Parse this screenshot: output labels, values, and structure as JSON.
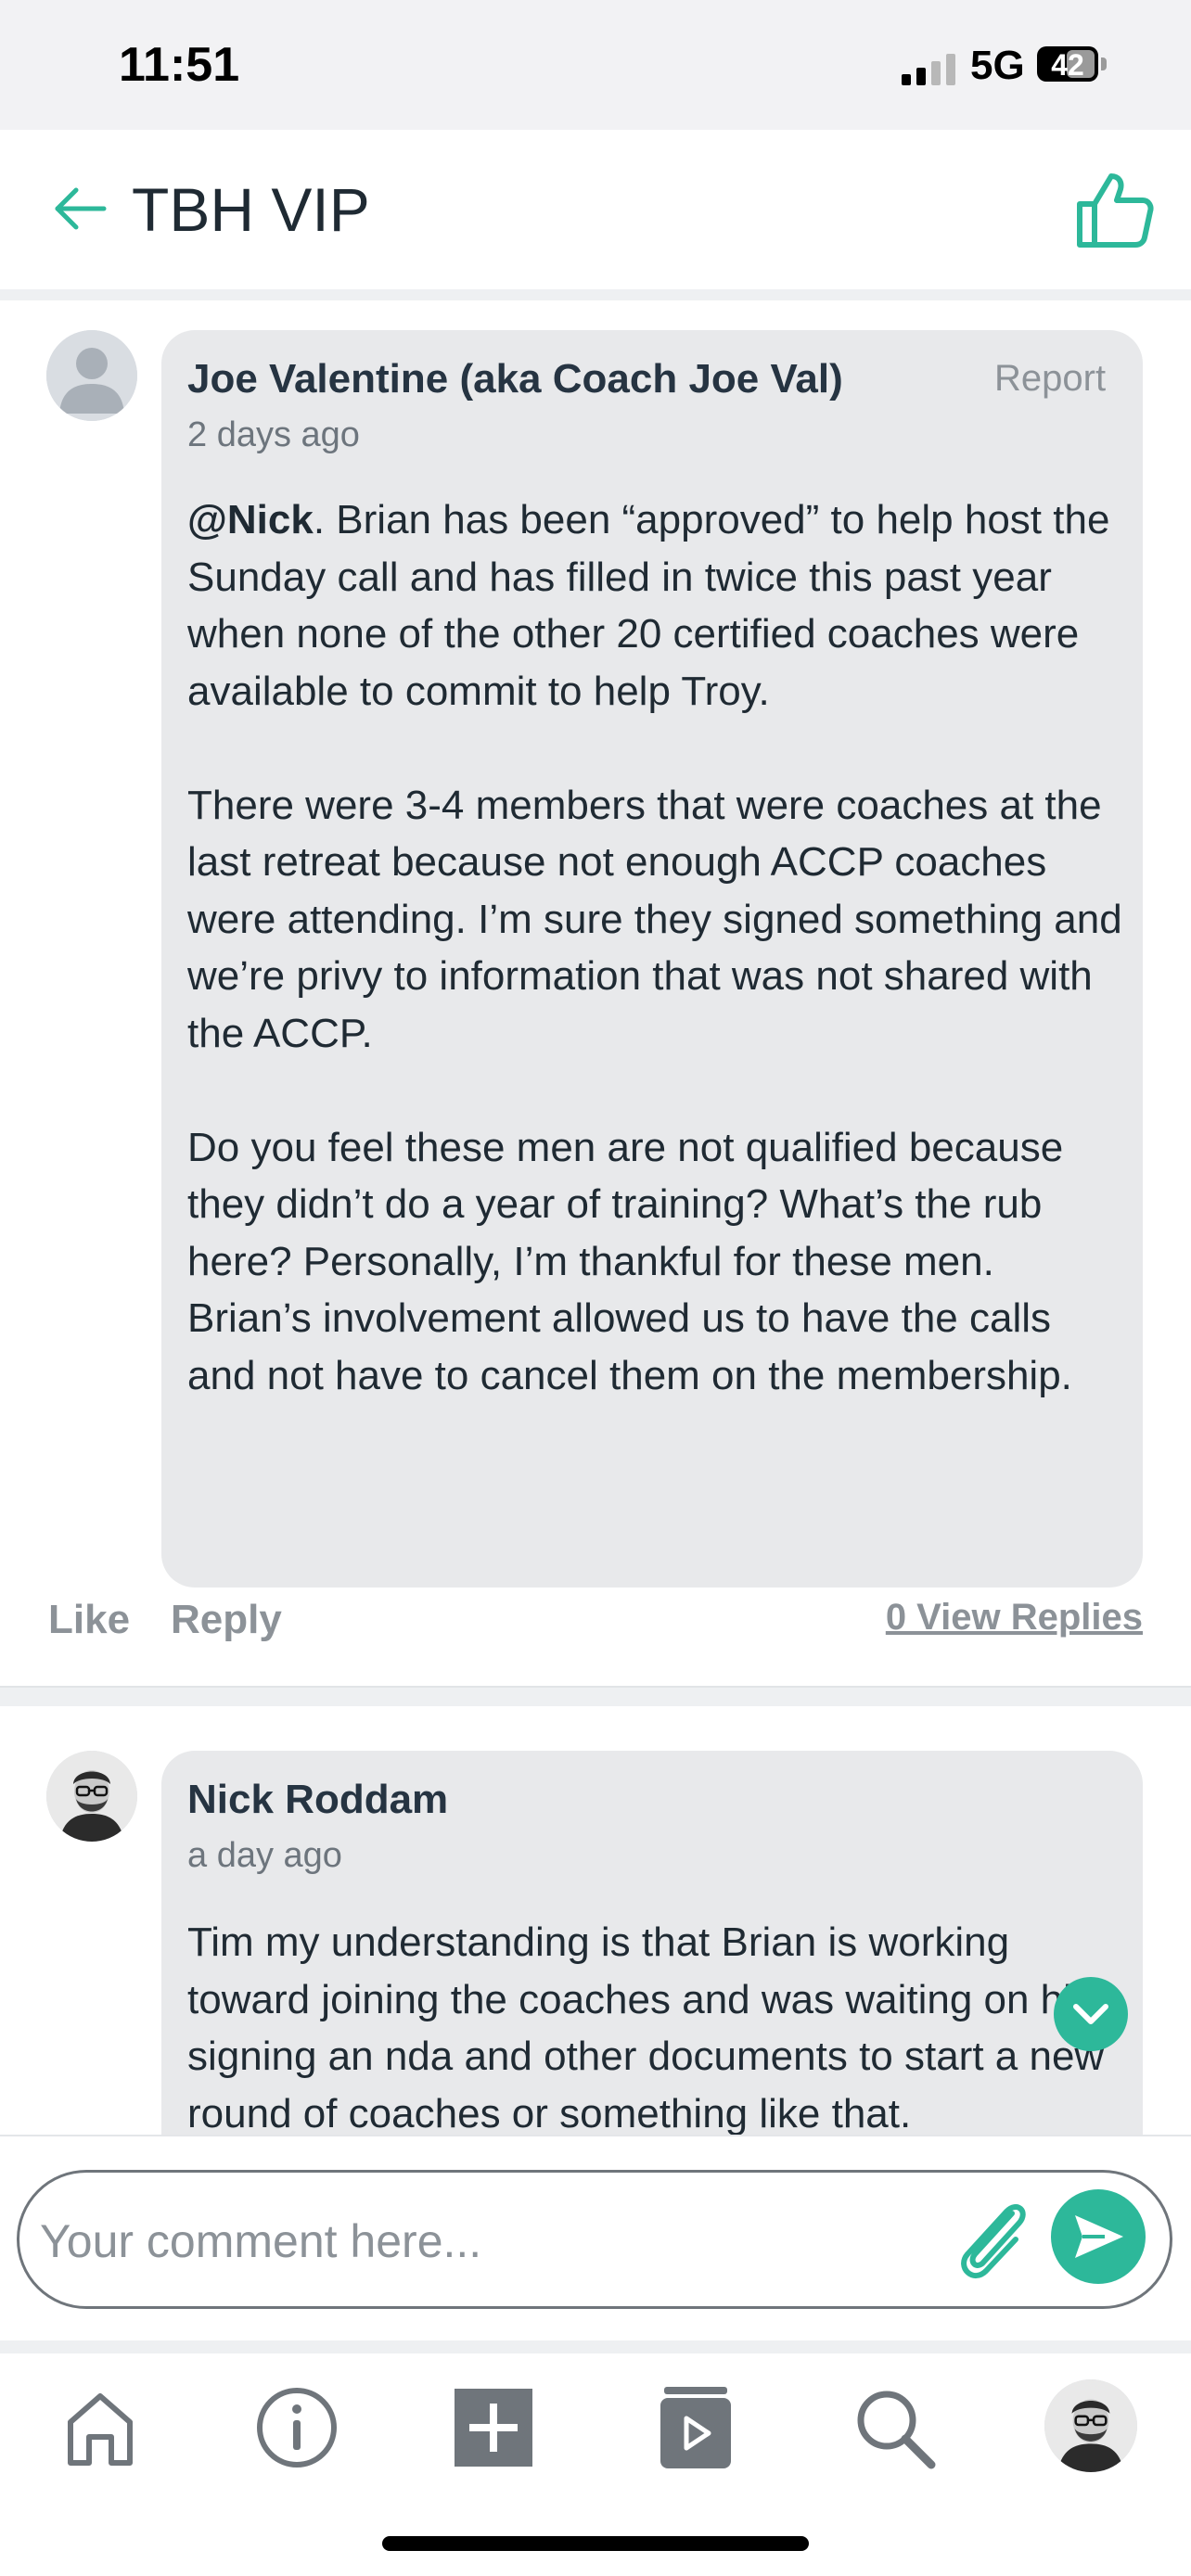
{
  "status_bar": {
    "time": "11:51",
    "network": "5G",
    "battery": "42"
  },
  "header": {
    "title": "TBH VIP"
  },
  "comments": [
    {
      "author": "Joe Valentine (aka Coach Joe Val)",
      "time": "2 days ago",
      "report_label": "Report",
      "mention": "@Nick",
      "paragraphs": [
        ".   Brian has been “approved” to help host the Sunday call and has filled in twice this past year when none of the other 20 certified coaches were available to commit to help Troy.",
        "There were 3-4 members that were coaches at the last retreat because not enough ACCP coaches were attending. I’m sure they signed something and we’re privy to information that was not shared with the ACCP.",
        "Do you feel these men are not qualified because they didn’t do a year of training?  What’s the rub here?  Personally, I’m thankful for these men. Brian’s involvement  allowed us to have the calls and not have to cancel them on the membership."
      ],
      "like_label": "Like",
      "reply_label": "Reply",
      "view_replies_label": "0 View Replies"
    },
    {
      "author": "Nick Roddam",
      "time": "a day ago",
      "paragraphs": [
        "Tim my understanding is that Brian is working toward joining the coaches and was waiting on him signing an nda and other documents to start a new round of coaches or something like that."
      ]
    }
  ],
  "composer": {
    "placeholder": "Your comment here..."
  },
  "icons": {
    "back": "back-arrow-icon",
    "like": "thumbs-up-icon",
    "attach": "paperclip-icon",
    "send": "send-icon",
    "scroll": "chevron-down-icon"
  },
  "tabs": [
    {
      "name": "home",
      "icon": "home-icon"
    },
    {
      "name": "info",
      "icon": "info-icon"
    },
    {
      "name": "add",
      "icon": "plus-icon"
    },
    {
      "name": "media",
      "icon": "play-book-icon"
    },
    {
      "name": "search",
      "icon": "search-icon"
    },
    {
      "name": "profile",
      "icon": "avatar"
    }
  ],
  "colors": {
    "accent": "#2db89a",
    "bubble": "#e8e9eb",
    "muted": "#8c9298"
  }
}
